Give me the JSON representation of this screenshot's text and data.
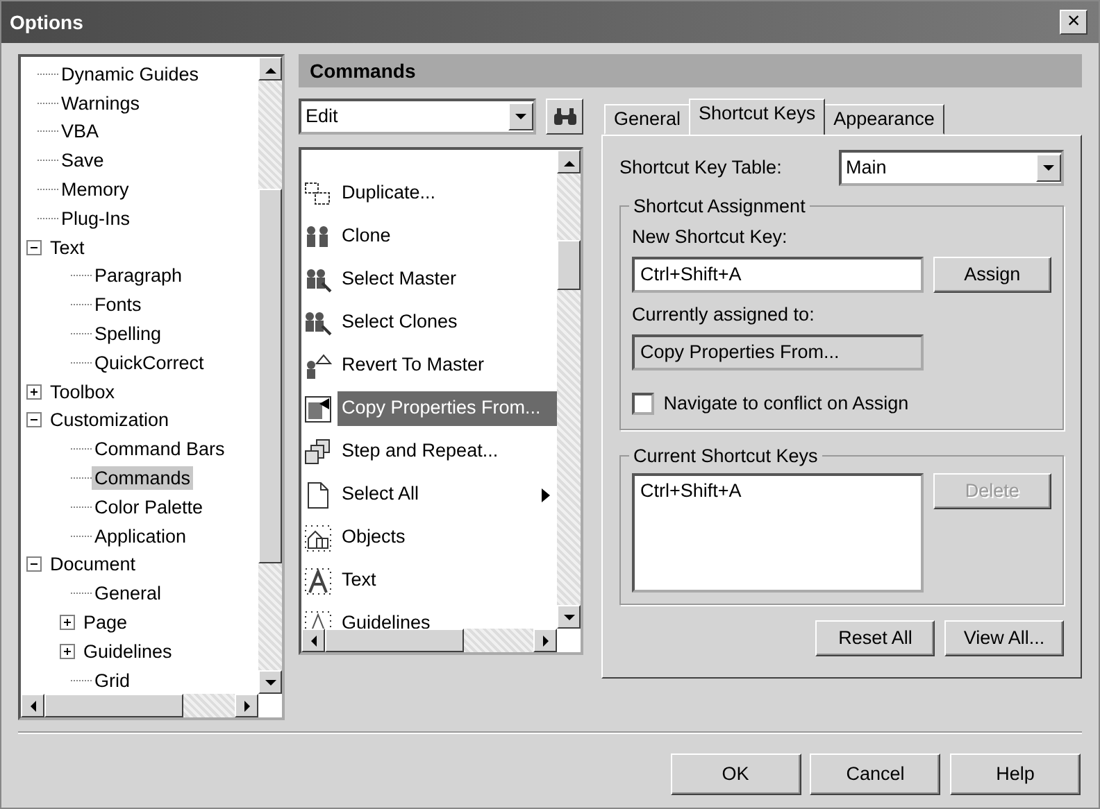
{
  "window": {
    "title": "Options",
    "close": "×"
  },
  "tree": [
    {
      "children": [
        {
          "label": "Dynamic Guides",
          "selected": false
        },
        {
          "label": "Warnings",
          "selected": false
        },
        {
          "label": "VBA",
          "selected": false
        },
        {
          "label": "Save",
          "selected": false
        },
        {
          "label": "Memory",
          "selected": false
        },
        {
          "label": "Plug-Ins",
          "selected": false
        },
        {
          "label": "Text",
          "selected": false,
          "expanded": true,
          "children": [
            {
              "label": "Paragraph",
              "selected": false
            },
            {
              "label": "Fonts",
              "selected": false
            },
            {
              "label": "Spelling",
              "selected": false
            },
            {
              "label": "QuickCorrect",
              "selected": false
            }
          ]
        },
        {
          "label": "Toolbox",
          "selected": false,
          "expanded": false
        },
        {
          "label": "Customization",
          "selected": false,
          "expanded": true,
          "children": [
            {
              "label": "Command Bars",
              "selected": false
            },
            {
              "label": "Commands",
              "selected": true
            },
            {
              "label": "Color Palette",
              "selected": false
            },
            {
              "label": "Application",
              "selected": false
            }
          ]
        }
      ]
    },
    {
      "label": "Document",
      "selected": false,
      "expanded": true,
      "children": [
        {
          "label": "General",
          "selected": false
        },
        {
          "label": "Page",
          "selected": false,
          "expanded": false
        },
        {
          "label": "Guidelines",
          "selected": false,
          "expanded": false
        },
        {
          "label": "Grid",
          "selected": false
        }
      ]
    }
  ],
  "header": "Commands",
  "category": {
    "value": "Edit"
  },
  "commands": [
    {
      "label": "Duplicate...",
      "selected": false,
      "submenu": false
    },
    {
      "label": "Clone",
      "selected": false,
      "submenu": false
    },
    {
      "label": "Select Master",
      "selected": false,
      "submenu": false
    },
    {
      "label": "Select Clones",
      "selected": false,
      "submenu": false
    },
    {
      "label": "Revert To Master",
      "selected": false,
      "submenu": false
    },
    {
      "label": "Copy Properties From...",
      "selected": true,
      "submenu": false
    },
    {
      "label": "Step and Repeat...",
      "selected": false,
      "submenu": false
    },
    {
      "label": "Select All",
      "selected": false,
      "submenu": true
    },
    {
      "label": "Objects",
      "selected": false,
      "submenu": false
    },
    {
      "label": "Text",
      "selected": false,
      "submenu": false
    },
    {
      "label": "Guidelines",
      "selected": false,
      "submenu": false
    }
  ],
  "tabs": [
    {
      "label": "General",
      "selected": false
    },
    {
      "label": "Shortcut Keys",
      "selected": true
    },
    {
      "label": "Appearance",
      "selected": false
    }
  ],
  "shortcut_table": {
    "label": "Shortcut Key Table:",
    "value": "Main"
  },
  "assignment": {
    "title": "Shortcut Assignment",
    "new_key_label": "New Shortcut Key:",
    "new_key_value": "Ctrl+Shift+A",
    "assign_button": "Assign",
    "assigned_label": "Currently assigned to:",
    "assigned_value": "Copy Properties From...",
    "navigate": {
      "label": "Navigate to conflict on Assign",
      "checked": false
    }
  },
  "current": {
    "title": "Current Shortcut Keys",
    "keys": [
      "Ctrl+Shift+A"
    ],
    "delete_button": {
      "label": "Delete",
      "disabled": true
    }
  },
  "panel_buttons": [
    "Reset All",
    "View All..."
  ],
  "buttons": [
    "OK",
    "Cancel",
    "Help"
  ]
}
